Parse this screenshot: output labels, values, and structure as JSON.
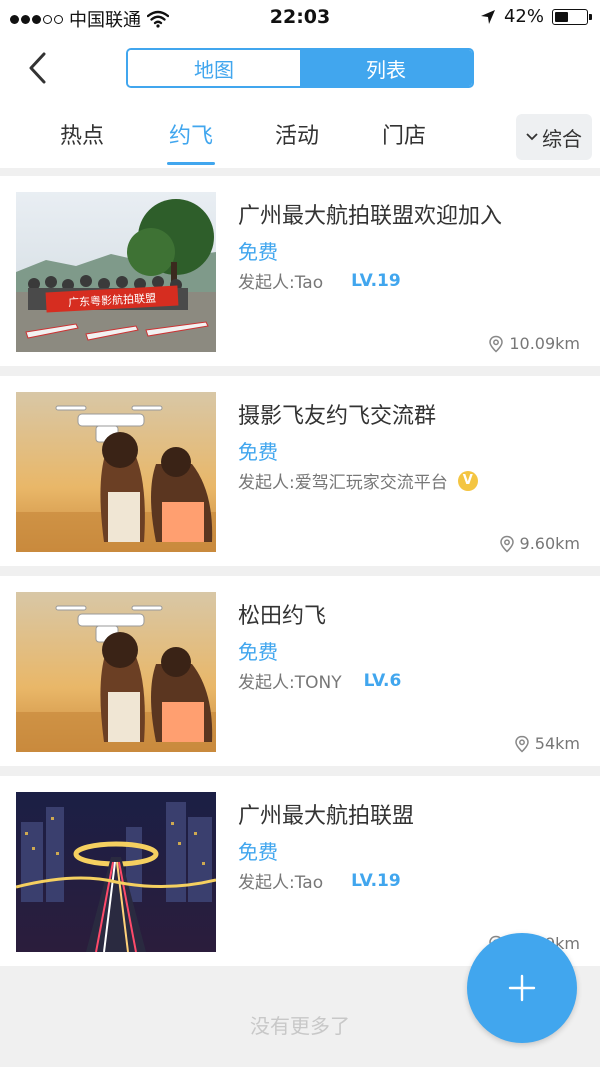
{
  "status_bar": {
    "carrier": "中国联通",
    "time": "22:03",
    "battery": "42%",
    "battery_level": 0.42,
    "signal_filled": 3,
    "signal_total": 5
  },
  "nav": {
    "segments": [
      "地图",
      "列表"
    ],
    "active_segment": 1
  },
  "tabs": {
    "items": [
      "热点",
      "约飞",
      "活动",
      "门店"
    ],
    "active": 1,
    "sort_label": "综合"
  },
  "banner_text": "广东粤影航拍联盟",
  "items": [
    {
      "title": "广州最大航拍联盟欢迎加入",
      "price": "免费",
      "owner": "发起人:Tao",
      "level": "LV.19",
      "verified": false,
      "distance": "10.09km"
    },
    {
      "title": "摄影飞友约飞交流群",
      "price": "免费",
      "owner": "发起人:爱驾汇玩家交流平台",
      "level": "",
      "verified": true,
      "verified_label": "V",
      "distance": "9.60km"
    },
    {
      "title": "松田约飞",
      "price": "免费",
      "owner": "发起人:TONY",
      "level": "LV.6",
      "verified": false,
      "distance": "54km"
    },
    {
      "title": "广州最大航拍联盟",
      "price": "免费",
      "owner": "发起人:Tao",
      "level": "LV.19",
      "verified": false,
      "distance": "10.09km"
    }
  ],
  "footer": {
    "no_more": "没有更多了"
  },
  "colors": {
    "accent": "#41a6ee",
    "badge": "#f4c542",
    "text": "#333333",
    "muted": "#777777"
  }
}
